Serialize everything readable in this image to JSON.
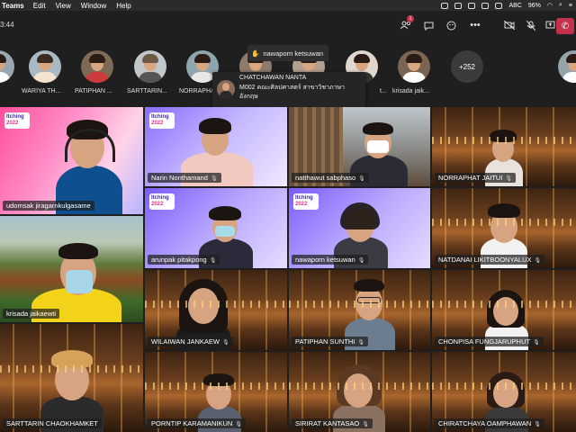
{
  "menubar": {
    "app_name": "Teams",
    "items": [
      "Edit",
      "View",
      "Window",
      "Help"
    ],
    "input_source": "ABC",
    "battery": "96%"
  },
  "toolbar": {
    "timer": "3:44",
    "people_badge": "1",
    "icons": [
      "people-icon",
      "chat-icon",
      "reactions-icon",
      "more-icon",
      "camera-off-icon",
      "mic-off-icon",
      "share-icon",
      "leave-icon"
    ]
  },
  "participants": [
    {
      "name": ""
    },
    {
      "name": "WARIYA TH..."
    },
    {
      "name": "PATIPHAN ..."
    },
    {
      "name": "SARTTARIN..."
    },
    {
      "name": "NORRAPHA..."
    },
    {
      "name": ""
    },
    {
      "name": ""
    },
    {
      "name": "t..."
    },
    {
      "name": "krisada jaik..."
    }
  ],
  "more_count": "+252",
  "raised_hand_tooltip": "nawaporn ketsuwan",
  "hover_card": {
    "name": "CHATCHAWAN NANTA",
    "description": "M002 คณะศิลปศาสตร์ สาขาวิชาภาษาอังกฤษ"
  },
  "event_logo": {
    "line1": "Itching",
    "line2": "2022"
  },
  "tiles": [
    {
      "name": "udomsak jiragarnkulgasame"
    },
    {
      "name": "Narin Nonthamand"
    },
    {
      "name": "natthawut sabphaso"
    },
    {
      "name": "NORRAPHAT JAITUI"
    },
    {
      "name": "krisada jaikaewti"
    },
    {
      "name": "arunpak pitakpong"
    },
    {
      "name": "nawaporn ketsuwan"
    },
    {
      "name": "NATDANAI LIKITBOONYALUX"
    },
    {
      "name": "WILAIWAN JANKAEW"
    },
    {
      "name": "PATIPHAN SUNTHI"
    },
    {
      "name": "CHONPISA FUNGJARUPHUT"
    },
    {
      "name": "SARTTARIN CHAOKHAMKET"
    },
    {
      "name": "PORNTIP KARAMANIKUN"
    },
    {
      "name": "SIRIRAT KANTASAO"
    },
    {
      "name": "CHIRATCHAYA OAMPHAWAN"
    }
  ],
  "colors": {
    "leave": "#c4314b",
    "bar": "#1f1f1f"
  }
}
